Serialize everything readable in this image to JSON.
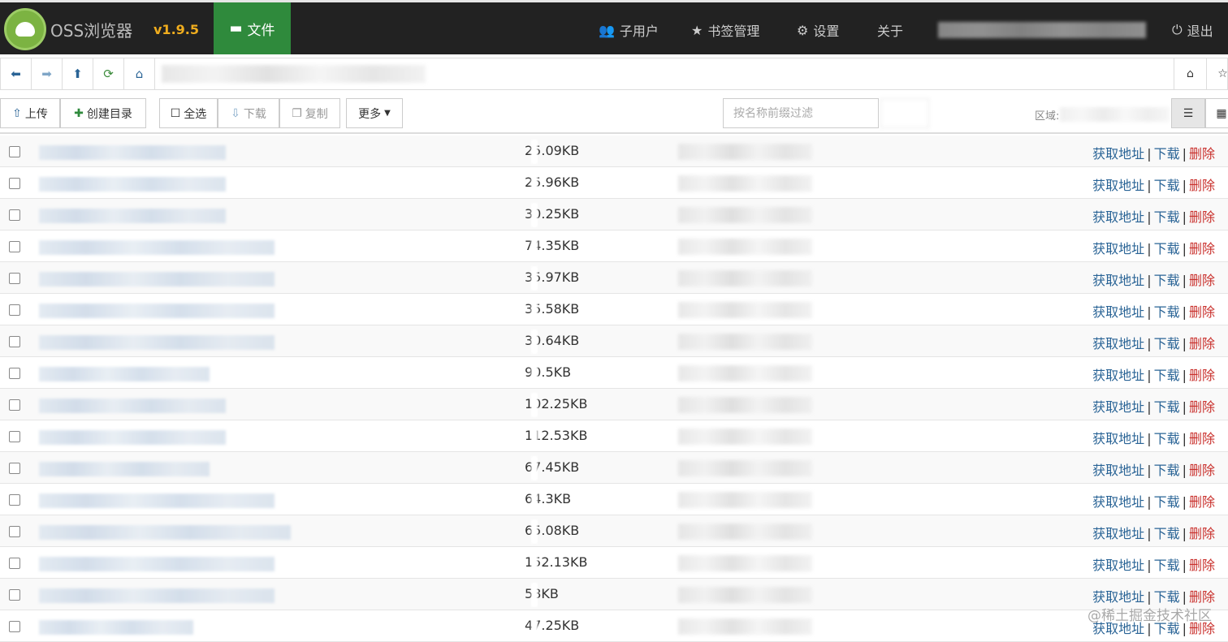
{
  "app": {
    "title": "OSS浏览器",
    "version": "v1.9.5"
  },
  "nav": {
    "files": "文件",
    "subusers": "子用户",
    "bookmarks": "书签管理",
    "settings": "设置",
    "about": "关于",
    "logout": "退出"
  },
  "toolbar": {
    "upload": "上传",
    "mkdir": "创建目录",
    "select_all": "全选",
    "download": "下载",
    "copy": "复制",
    "more": "更多",
    "filter_placeholder": "按名称前缀过滤",
    "region_label": "区域:"
  },
  "actions": {
    "get_url": "获取地址",
    "download": "下载",
    "delete": "删除",
    "separator": "|"
  },
  "files": [
    {
      "size": "25.09KB"
    },
    {
      "size": "25.96KB"
    },
    {
      "size": "30.25KB"
    },
    {
      "size": "74.35KB"
    },
    {
      "size": "35.97KB"
    },
    {
      "size": "35.58KB"
    },
    {
      "size": "30.64KB"
    },
    {
      "size": "90.5KB"
    },
    {
      "size": "102.25KB"
    },
    {
      "size": "112.53KB"
    },
    {
      "size": "67.45KB"
    },
    {
      "size": "64.3KB"
    },
    {
      "size": "65.08KB"
    },
    {
      "size": "152.13KB"
    },
    {
      "size": "58KB"
    },
    {
      "size": "47.25KB"
    }
  ],
  "watermark": "@稀土掘金技术社区"
}
